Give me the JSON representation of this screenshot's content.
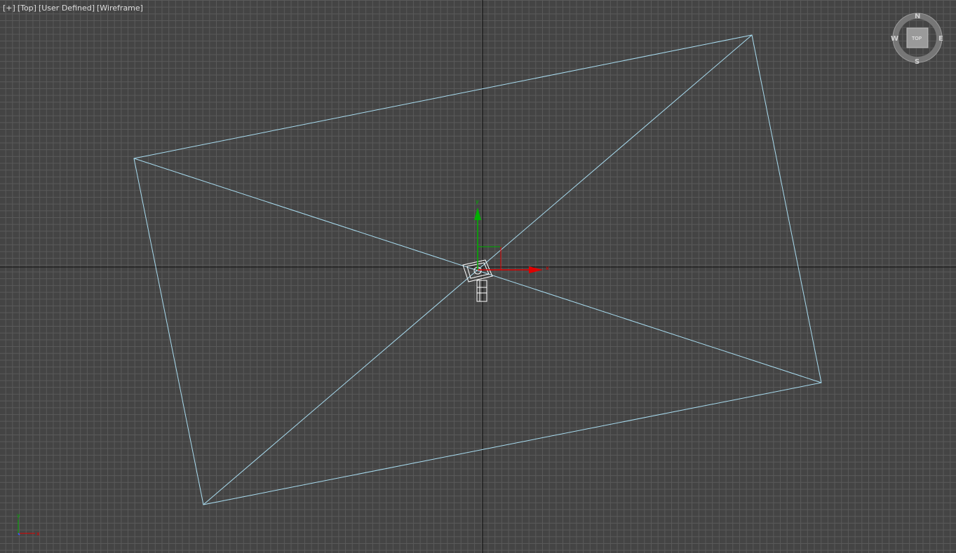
{
  "viewport": {
    "labels": {
      "plus_menu": "[+]",
      "view_name": "[Top]",
      "shading_preset": "[User Defined]",
      "display_mode": "[Wireframe]"
    },
    "view_cube": {
      "north": "N",
      "south": "S",
      "east": "E",
      "west": "W",
      "face": "TOP"
    },
    "gizmo": {
      "y_label": "y",
      "x_label": "x"
    },
    "world_axis": {
      "y_label": "y",
      "x_label": "x"
    },
    "colors": {
      "background": "#444444",
      "grid": "#5a5a5a",
      "home_grid_axis": "#111111",
      "wireframe": "#a8dcf0",
      "selection": "#ffffff",
      "x_axis": "#e00000",
      "y_axis": "#00b000"
    }
  }
}
